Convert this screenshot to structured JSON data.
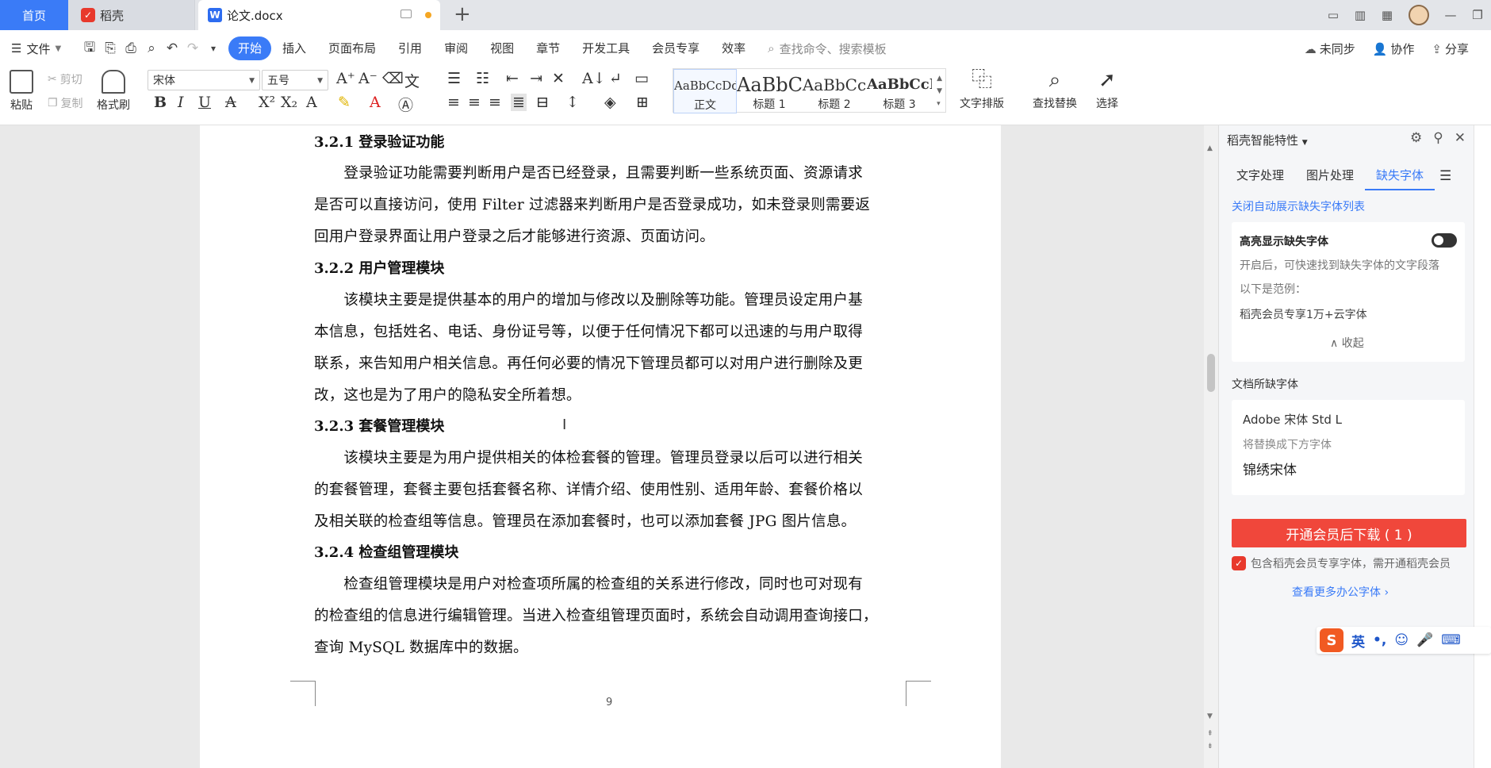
{
  "tabs": {
    "home": "首页",
    "daoke": "稻壳",
    "doc": "论文.docx",
    "plus": "+"
  },
  "menubar": {
    "file": "文件",
    "items": [
      "开始",
      "插入",
      "页面布局",
      "引用",
      "审阅",
      "视图",
      "章节",
      "开发工具",
      "会员专享",
      "效率"
    ],
    "search_placeholder": "查找命令、搜索模板",
    "unsynced": "未同步",
    "collab": "协作",
    "share": "分享"
  },
  "ribbon": {
    "paste": "粘贴",
    "cut": "剪切",
    "copy": "复制",
    "format_painter": "格式刷",
    "font_name": "宋体",
    "font_size": "五号",
    "styles": [
      {
        "sample": "AaBbCcDd",
        "name": "正文"
      },
      {
        "sample": "AaBbC",
        "name": "标题 1"
      },
      {
        "sample": "AaBbCc",
        "name": "标题 2"
      },
      {
        "sample": "AaBbCcI",
        "name": "标题 3"
      }
    ],
    "text_layout": "文字排版",
    "find_replace": "查找替换",
    "select": "选择"
  },
  "document": {
    "sections": [
      {
        "heading": "3.2.1  登录验证功能",
        "lines": [
          "　　登录验证功能需要判断用户是否已经登录，且需要判断一些系统页面、资源请求",
          "是否可以直接访问，使用 Filter 过滤器来判断用户是否登录成功，如未登录则需要返",
          "回用户登录界面让用户登录之后才能够进行资源、页面访问。"
        ]
      },
      {
        "heading": "3.2.2  用户管理模块",
        "lines": [
          "　　该模块主要是提供基本的用户的增加与修改以及删除等功能。管理员设定用户基",
          "本信息，包括姓名、电话、身份证号等，以便于任何情况下都可以迅速的与用户取得",
          "联系，来告知用户相关信息。再任何必要的情况下管理员都可以对用户进行删除及更",
          "改，这也是为了用户的隐私安全所着想。"
        ]
      },
      {
        "heading": "3.2.3  套餐管理模块",
        "lines": [
          "　　该模块主要是为用户提供相关的体检套餐的管理。管理员登录以后可以进行相关",
          "的套餐管理，套餐主要包括套餐名称、详情介绍、使用性别、适用年龄、套餐价格以",
          "及相关联的检查组等信息。管理员在添加套餐时，也可以添加套餐 JPG 图片信息。"
        ]
      },
      {
        "heading": "3.2.4  检查组管理模块",
        "lines": [
          "　　检查组管理模块是用户对检查项所属的检查组的关系进行修改，同时也可对现有",
          "的检查组的信息进行编辑管理。当进入检查组管理页面时，系统会自动调用查询接口，",
          "查询 MySQL 数据库中的数据。"
        ]
      }
    ],
    "page_number": "9"
  },
  "panel": {
    "title": "稻壳智能特性",
    "tabs": [
      "文字处理",
      "图片处理",
      "缺失字体"
    ],
    "close_auto_link": "关闭自动展示缺失字体列表",
    "highlight_title": "高亮显示缺失字体",
    "highlight_desc": "开启后，可快速找到缺失字体的文字段落",
    "example_label": "以下是范例：",
    "example_text": "稻壳会员专享1万+云字体",
    "collapse": "收起",
    "missing_title": "文档所缺字体",
    "missing_font": "Adobe 宋体 Std L",
    "replace_label": "将替换成下方字体",
    "replace_font": "锦绣宋体",
    "download_btn": "开通会员后下载 ( 1 )",
    "member_note": "包含稻壳会员专享字体，需开通稻壳会员",
    "more_link": "查看更多办公字体"
  },
  "ime": {
    "logo": "S",
    "lang": "英"
  },
  "colors": {
    "accent": "#3a7bf7",
    "danger": "#f0473b"
  }
}
